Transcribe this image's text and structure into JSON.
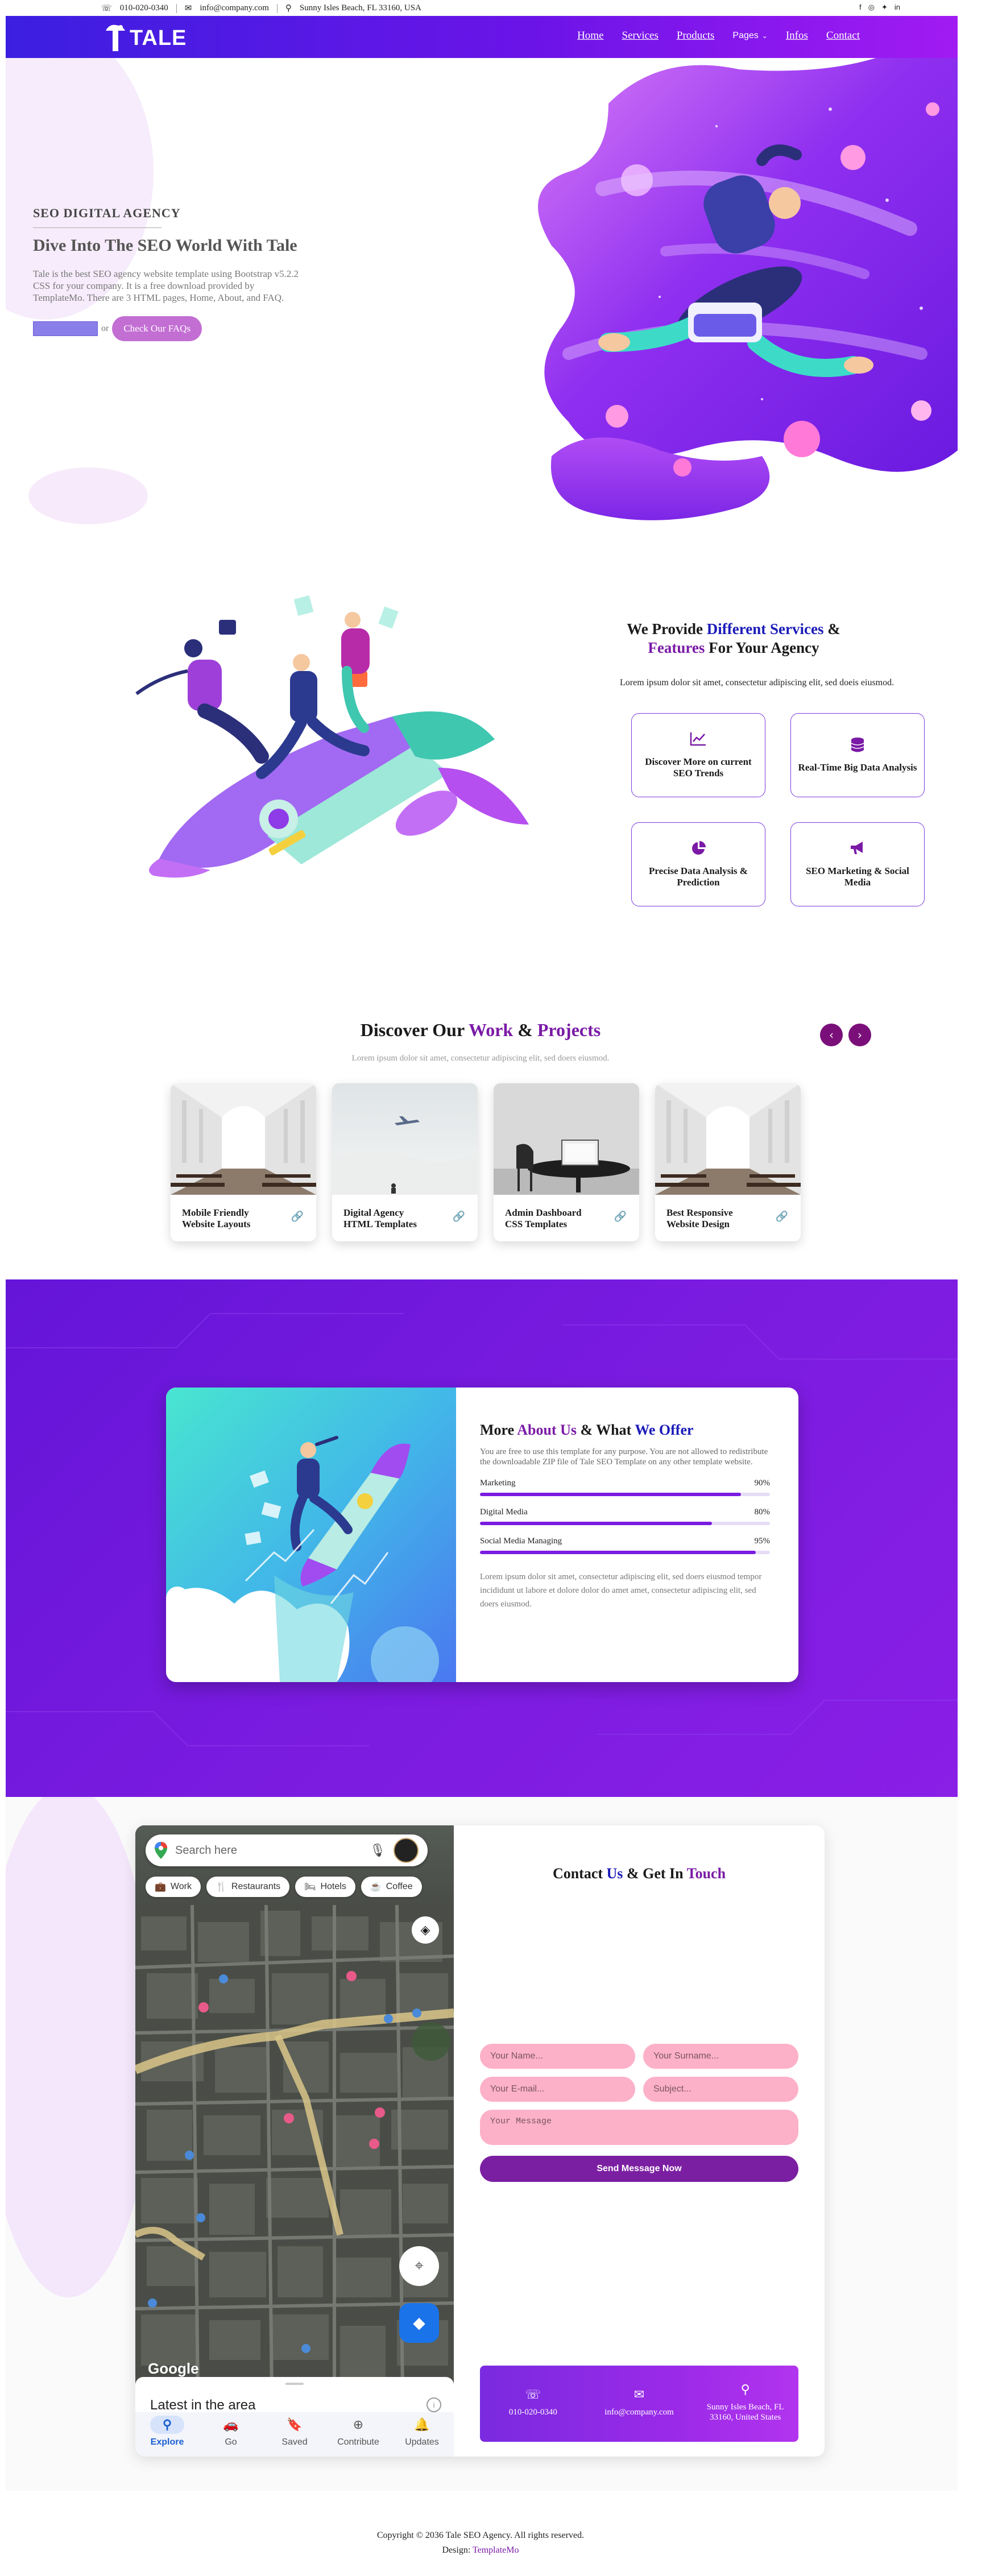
{
  "topbar": {
    "phone": "010-020-0340",
    "email": "info@company.com",
    "address": "Sunny Isles Beach, FL 33160, USA",
    "social_icons": [
      "facebook-icon",
      "instagram-icon",
      "twitter-icon",
      "linkedin-icon"
    ]
  },
  "header": {
    "logo": "TALE",
    "nav": [
      "Home",
      "Services",
      "Products",
      "Pages",
      "Infos",
      "Contact"
    ]
  },
  "hero": {
    "kicker": "SEO DIGITAL AGENCY",
    "title": "Dive Into The SEO World With Tale",
    "description": "Tale is the best SEO agency website template using Bootstrap v5.2.2 CSS for your company. It is a free download provided by TemplateMo. There are 3 HTML pages, Home, About, and FAQ.",
    "or": "or",
    "faq_button": "Check Our FAQs"
  },
  "services": {
    "title_a": "We Provide ",
    "title_b": "Different Services",
    "title_c": " & ",
    "title_d": "Features",
    "title_e": " For Your Agency",
    "description": "Lorem ipsum dolor sit amet, consectetur adipiscing elit, sed doeis eiusmod.",
    "cards": [
      {
        "icon": "chart-line-icon",
        "label": "Discover More on current SEO Trends"
      },
      {
        "icon": "database-icon",
        "label": "Real-Time Big Data Analysis"
      },
      {
        "icon": "pie-chart-icon",
        "label": "Precise Data Analysis & Prediction"
      },
      {
        "icon": "megaphone-icon",
        "label": "SEO Marketing & Social Media"
      }
    ]
  },
  "projects": {
    "title_a": "Discover Our ",
    "title_b": "Work",
    "title_c": " & ",
    "title_d": "Projects",
    "subtitle": "Lorem ipsum dolor sit amet, consectetur adipiscing elit, sed doers eiusmod.",
    "items": [
      {
        "label": "Mobile Friendly Website Layouts"
      },
      {
        "label": "Digital Agency HTML Templates"
      },
      {
        "label": "Admin Dashboard CSS Templates"
      },
      {
        "label": "Best Responsive Website Design"
      }
    ]
  },
  "about": {
    "title_a": "More ",
    "title_b": "About Us",
    "title_c": " & What ",
    "title_d": "We Offer",
    "description": "You are free to use this template for any purpose. You are not allowed to redistribute the downloadable ZIP file of Tale SEO Template on any other template website.",
    "skills": [
      {
        "label": "Marketing",
        "percent_label": "90%",
        "value": 0.9
      },
      {
        "label": "Digital Media",
        "percent_label": "80%",
        "value": 0.8
      },
      {
        "label": "Social Media Managing",
        "percent_label": "95%",
        "value": 0.95
      }
    ],
    "footer_text": "Lorem ipsum dolor sit amet, consectetur adipiscing elit, sed doers eiusmod tempor incididunt ut labore et dolore dolor do amet amet, consectetur adipiscing elit, sed doers eiusmod."
  },
  "map": {
    "search_placeholder": "Search here",
    "chips": [
      {
        "icon": "briefcase-icon",
        "label": "Work"
      },
      {
        "icon": "fork-knife-icon",
        "label": "Restaurants"
      },
      {
        "icon": "bed-icon",
        "label": "Hotels"
      },
      {
        "icon": "coffee-icon",
        "label": "Coffee"
      }
    ],
    "watermark": "Google",
    "sheet_title": "Latest in the area",
    "tabs": [
      {
        "icon": "pin-icon",
        "label": "Explore"
      },
      {
        "icon": "car-icon",
        "label": "Go"
      },
      {
        "icon": "bookmark-icon",
        "label": "Saved"
      },
      {
        "icon": "plus-circle-icon",
        "label": "Contribute"
      },
      {
        "icon": "bell-icon",
        "label": "Updates"
      }
    ],
    "active_tab": "Explore"
  },
  "contact": {
    "title_a": "Contact ",
    "title_b": "Us",
    "title_c": " & Get In ",
    "title_d": "Touch",
    "placeholders": {
      "name": "Your Name...",
      "surname": "Your Surname...",
      "email": "Your E-mail...",
      "subject": "Subject...",
      "message": "Your Message"
    },
    "send_button": "Send Message Now",
    "info": {
      "phone": "010-020-0340",
      "email": "info@company.com",
      "address": "Sunny Isles Beach, FL 33160, United States"
    }
  },
  "footer": {
    "copyright": "Copyright © 2036 Tale SEO Agency. All rights reserved.",
    "design_label": "Design: ",
    "design_link": "TemplateMo"
  },
  "colors": {
    "header_gradient_start": "#3b1fe0",
    "header_gradient_end": "#a11bf2",
    "accent_purple": "#7a1aa6",
    "accent_blue": "#1b1bb8",
    "form_input": "#fcb1c8",
    "about_bg": "#6f18dc"
  }
}
